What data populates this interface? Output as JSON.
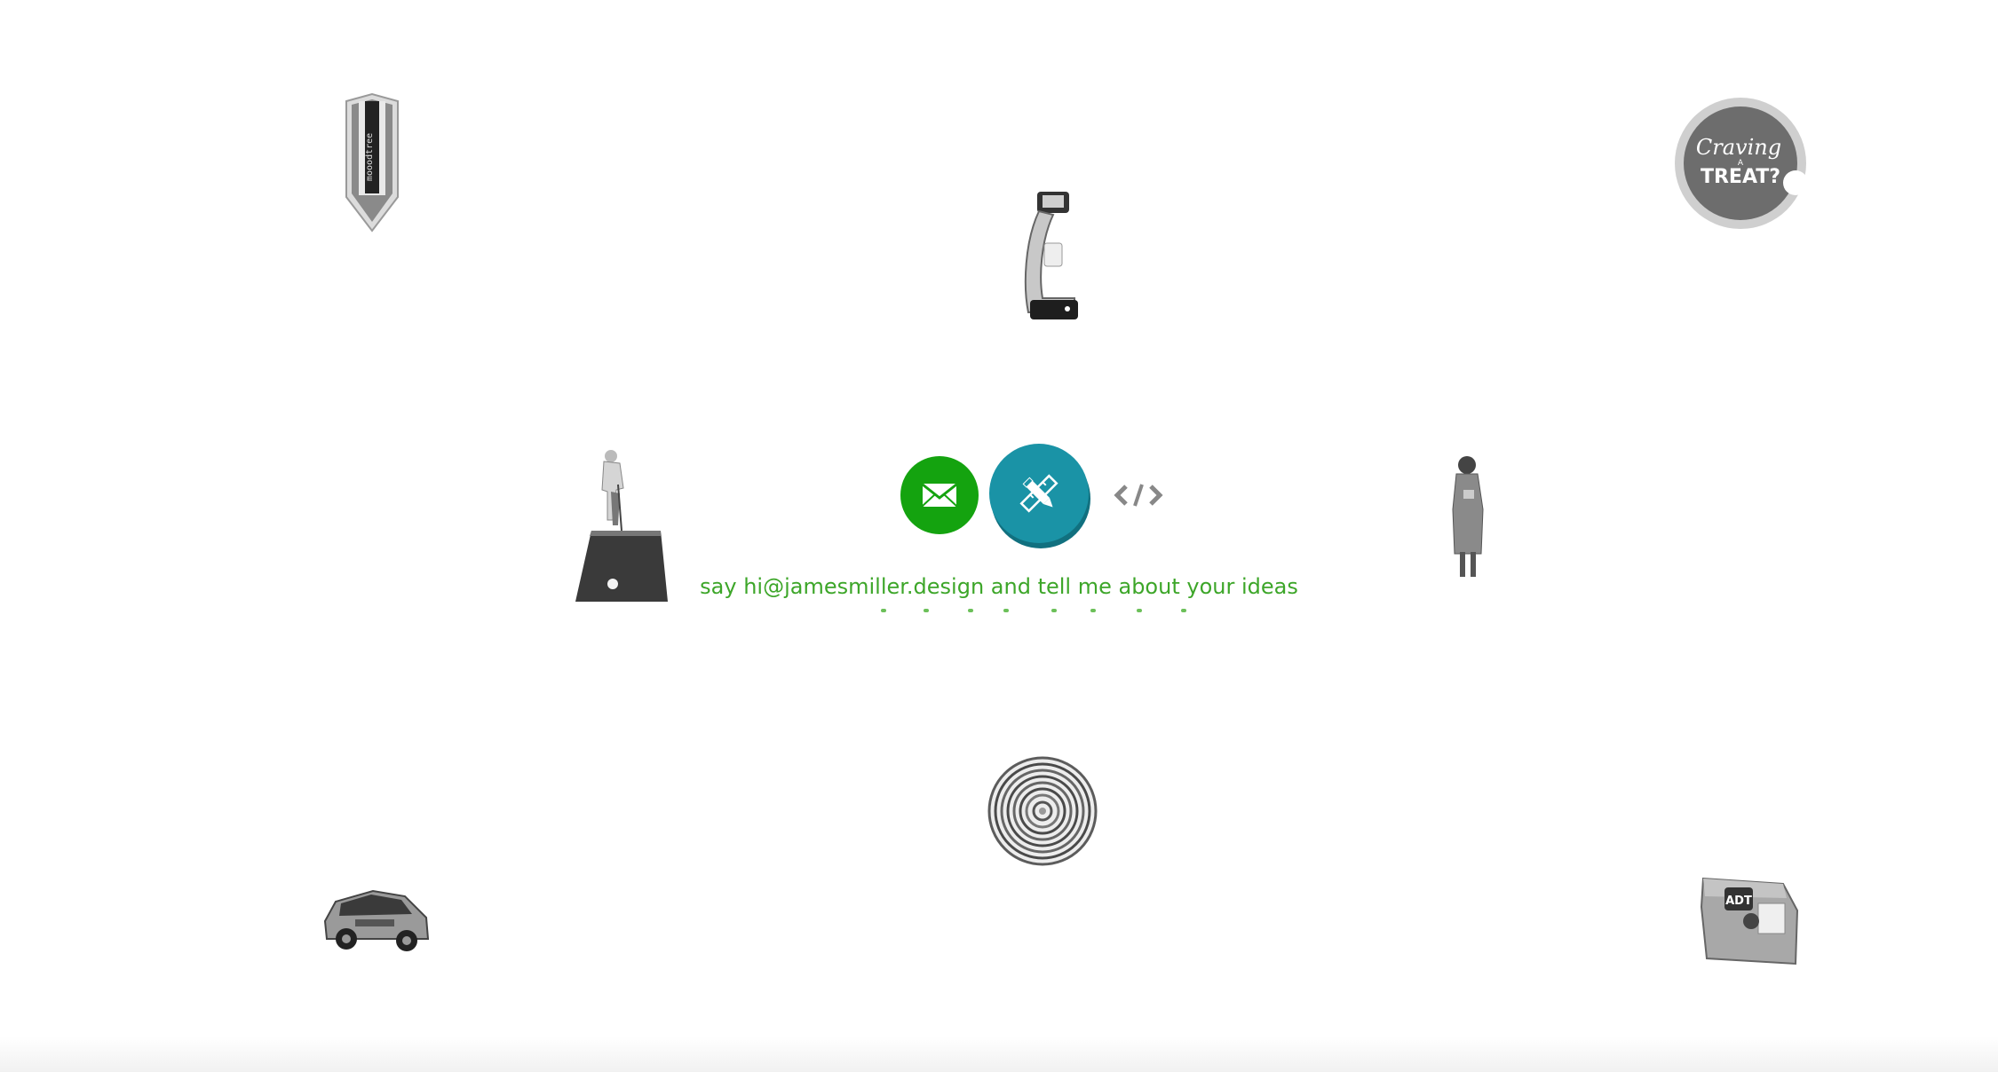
{
  "tagline": "say hi@jamesmiller.design and tell me about your ideas",
  "colors": {
    "mail_button": "#14a30f",
    "design_button": "#1a93a6",
    "design_button_shadow": "#11707f",
    "tagline": "#3da629",
    "code_icon": "#888888"
  },
  "buttons": {
    "mail_icon": "envelope-icon",
    "design_icon": "pencil-ruler-icon",
    "code_icon": "code-brackets-icon"
  },
  "projects": [
    {
      "name": "pencil-banner",
      "logo_text": "mooodtree"
    },
    {
      "name": "drink-dispenser"
    },
    {
      "name": "craving-a-treat",
      "line1": "Craving",
      "line2": "A",
      "line3": "TREAT?"
    },
    {
      "name": "golfer-putting-green"
    },
    {
      "name": "woman-standing"
    },
    {
      "name": "concentric-rings"
    },
    {
      "name": "car"
    },
    {
      "name": "adt-bag",
      "logo_text": "ADT"
    }
  ]
}
